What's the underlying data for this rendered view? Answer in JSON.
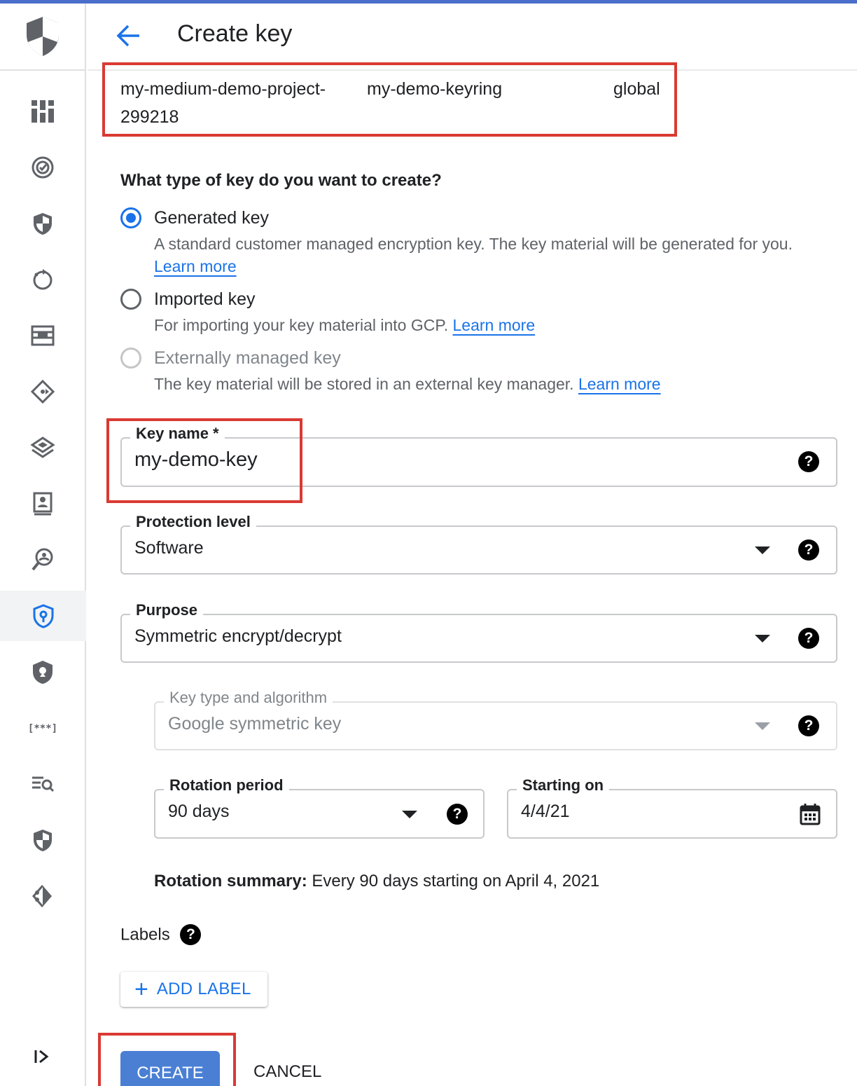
{
  "header": {
    "title": "Create key"
  },
  "context": {
    "project": "my-medium-demo-project-",
    "project_suffix": "299218",
    "keyring": "my-demo-keyring",
    "location": "global"
  },
  "key_type": {
    "question": "What type of key do you want to create?",
    "options": [
      {
        "label": "Generated key",
        "description": "A standard customer managed encryption key. The key material will be generated for you.",
        "link": "Learn more",
        "selected": true
      },
      {
        "label": "Imported key",
        "description": "For importing your key material into GCP.",
        "link": "Learn more",
        "selected": false
      },
      {
        "label": "Externally managed key",
        "description": "The key material will be stored in an external key manager.",
        "link": "Learn more",
        "selected": false,
        "disabled": true
      }
    ]
  },
  "fields": {
    "key_name": {
      "label": "Key name *",
      "value": "my-demo-key"
    },
    "protection_level": {
      "label": "Protection level",
      "value": "Software"
    },
    "purpose": {
      "label": "Purpose",
      "value": "Symmetric encrypt/decrypt"
    },
    "algorithm": {
      "label": "Key type and algorithm",
      "value": "Google symmetric key"
    },
    "rotation_period": {
      "label": "Rotation period",
      "value": "90 days"
    },
    "starting_on": {
      "label": "Starting on",
      "value": "4/4/21"
    }
  },
  "summary": {
    "label": "Rotation summary:",
    "text": " Every 90 days starting on April 4, 2021"
  },
  "labels": {
    "title": "Labels",
    "add_label": "ADD LABEL"
  },
  "help_glyph": "?",
  "plus_glyph": "+",
  "actions": {
    "create": "CREATE",
    "cancel": "CANCEL"
  },
  "colors": {
    "primary": "#1a73e8",
    "highlight": "#d93a33",
    "create_button": "#4a7fd4"
  },
  "sidebar_icons": [
    "security-shield-logo",
    "dashboard-icon",
    "security-command-icon",
    "shield-icon",
    "refresh-icon",
    "firewall-icon",
    "network-icon",
    "layers-icon",
    "badge-icon",
    "identity-search-icon",
    "key-management-icon",
    "policy-icon",
    "secret-icon",
    "search-list-icon",
    "shield-icon",
    "certificate-icon",
    "expand-icon"
  ]
}
